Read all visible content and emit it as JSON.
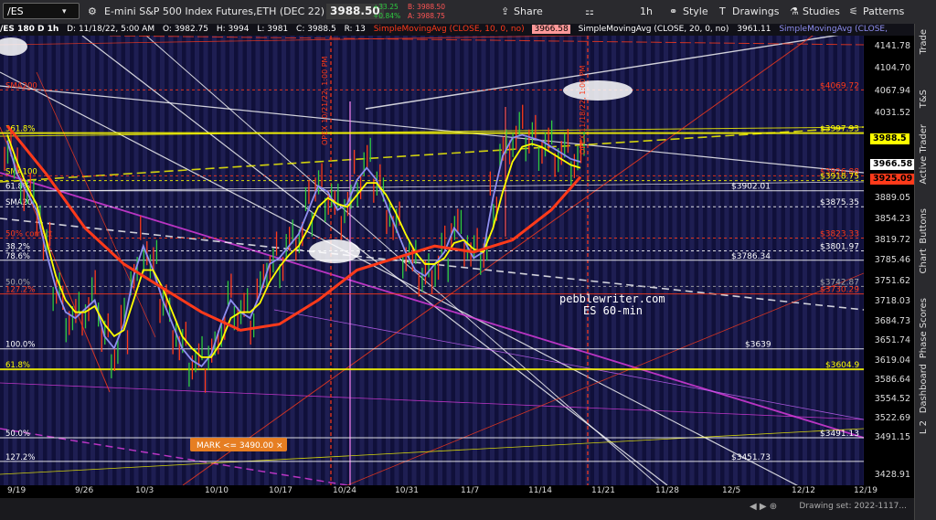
{
  "toolbar": {
    "symbol": "/ES",
    "description": "E-mini S&P 500 Index Futures,ETH (DEC 22)",
    "last_price": "3988.50",
    "net_change": "+33.25",
    "pct_change": "+0.84%",
    "bid": "B: 3988.50",
    "ask": "A: 3988.75",
    "share": "Share",
    "interval": "1h",
    "style": "Style",
    "drawings": "Drawings",
    "studies": "Studies",
    "patterns": "Patterns"
  },
  "header": {
    "chart_id": "/ES 180 D 1h",
    "date": "D: 11/18/22, 5:00 AM",
    "open": "O: 3982.75",
    "high": "H: 3994",
    "low": "L: 3981",
    "close": "C: 3988.5",
    "range": "R: 13",
    "sma10": "SimpleMovingAvg (CLOSE, 10, 0, no)",
    "sma10_val": "3966.58",
    "sma20": "SimpleMovingAvg (CLOSE, 20, 0, no)",
    "sma20_val": "3961.11",
    "sma_next": "SimpleMovingAvg (CLOSE,"
  },
  "side_tabs": [
    "Trade",
    "T&S",
    "Active Trader",
    "Buttons",
    "Chart",
    "Phase Scores",
    "Dashboard",
    "L 2"
  ],
  "status": {
    "drawing_set": "Drawing set: 2022-1117..."
  },
  "colors": {
    "bg": "#10103a",
    "stripe": "#2a2a66",
    "yellow": "#ffff00",
    "red": "#ff2a2a",
    "orange_red": "#ff4d00",
    "magenta": "#e23ce2",
    "white": "#ffffff",
    "orange_box": "#e67e22"
  },
  "chart_data": {
    "type": "line",
    "title": "/ES 180 D 1h",
    "ylim": [
      3412,
      4160
    ],
    "y_ticks": [
      4141.78,
      4104.7,
      4067.94,
      4031.52,
      3889.05,
      3854.23,
      3819.72,
      3785.46,
      3751.62,
      3718.03,
      3684.73,
      3651.74,
      3619.04,
      3586.64,
      3554.52,
      3522.69,
      3491.15,
      3428.91
    ],
    "x_ticks": [
      "9/19",
      "9/26",
      "10/3",
      "10/10",
      "10/17",
      "10/24",
      "10/31",
      "11/7",
      "11/14",
      "11/21",
      "11/28",
      "12/5",
      "12/12",
      "12/19"
    ],
    "grid": false,
    "legend": "none",
    "series": [
      {
        "name": "SimpleMovingAvg (CLOSE, 10, 0, no)",
        "color": "#8e8ef0",
        "x": [
          0,
          1,
          2,
          3,
          4,
          5,
          6,
          7,
          8,
          9,
          10,
          11,
          12,
          13,
          14,
          15,
          16,
          17,
          18,
          19,
          20,
          21,
          22,
          23,
          24,
          25,
          26,
          27,
          28,
          29,
          30,
          31,
          32,
          33,
          34,
          35,
          36,
          37,
          38,
          39,
          40,
          41,
          42,
          43,
          44,
          45,
          46,
          47,
          48,
          49,
          50,
          51,
          52,
          53,
          54,
          55,
          56,
          57,
          58,
          59
        ],
        "values": [
          3985,
          3930,
          3900,
          3870,
          3800,
          3740,
          3700,
          3690,
          3705,
          3720,
          3660,
          3640,
          3680,
          3760,
          3810,
          3770,
          3720,
          3680,
          3640,
          3620,
          3610,
          3630,
          3680,
          3720,
          3700,
          3690,
          3730,
          3780,
          3790,
          3810,
          3830,
          3870,
          3910,
          3900,
          3870,
          3880,
          3920,
          3940,
          3920,
          3880,
          3840,
          3800,
          3770,
          3760,
          3780,
          3800,
          3840,
          3820,
          3790,
          3800,
          3890,
          3960,
          3990,
          3995,
          3990,
          3985,
          3975,
          3965,
          3955,
          3950
        ]
      },
      {
        "name": "SimpleMovingAvg (CLOSE, 20, 0, no)",
        "color": "#ffff00",
        "x": [
          0,
          1,
          2,
          3,
          4,
          5,
          6,
          7,
          8,
          9,
          10,
          11,
          12,
          13,
          14,
          15,
          16,
          17,
          18,
          19,
          20,
          21,
          22,
          23,
          24,
          25,
          26,
          27,
          28,
          29,
          30,
          31,
          32,
          33,
          34,
          35,
          36,
          37,
          38,
          39,
          40,
          41,
          42,
          43,
          44,
          45,
          46,
          47,
          48,
          49,
          50,
          51,
          52,
          53,
          54,
          55,
          56,
          57,
          58,
          59
        ],
        "values": [
          3995,
          3950,
          3910,
          3880,
          3820,
          3760,
          3720,
          3700,
          3700,
          3710,
          3680,
          3660,
          3670,
          3720,
          3770,
          3770,
          3740,
          3700,
          3660,
          3640,
          3625,
          3625,
          3650,
          3690,
          3700,
          3700,
          3715,
          3750,
          3775,
          3795,
          3810,
          3840,
          3875,
          3890,
          3880,
          3875,
          3895,
          3915,
          3915,
          3895,
          3865,
          3830,
          3800,
          3780,
          3780,
          3790,
          3815,
          3820,
          3805,
          3800,
          3840,
          3900,
          3950,
          3975,
          3980,
          3975,
          3965,
          3955,
          3945,
          3940
        ]
      },
      {
        "name": "SMA50",
        "color": "#ff3a1a",
        "x": [
          0,
          4,
          8,
          12,
          16,
          20,
          24,
          28,
          32,
          36,
          40,
          44,
          48,
          52,
          56,
          59
        ],
        "values": [
          4010,
          3930,
          3840,
          3780,
          3740,
          3700,
          3670,
          3680,
          3720,
          3770,
          3790,
          3810,
          3800,
          3820,
          3870,
          3925
        ]
      }
    ],
    "horizontal_levels": [
      {
        "label": "$4069.72",
        "value": 4069.72,
        "color": "#ff3a1a",
        "style": "dotted"
      },
      {
        "label": "$3997.93",
        "value": 3997.93,
        "color": "#ffff00",
        "style": "solid"
      },
      {
        "label": "$3926.88",
        "value": 3926.88,
        "color": "#ff3a1a",
        "style": "dotted"
      },
      {
        "label": "$3918.75",
        "value": 3918.75,
        "color": "#ffff00",
        "style": "dotted"
      },
      {
        "label": "$3902.01",
        "value": 3902.01,
        "color": "#ffffff",
        "style": "solid"
      },
      {
        "label": "$3875.35",
        "value": 3875.35,
        "color": "#ffffff",
        "style": "dotted"
      },
      {
        "label": "$3823.33",
        "value": 3823.33,
        "color": "#ff3a1a",
        "style": "dotted"
      },
      {
        "label": "$3801.97",
        "value": 3801.97,
        "color": "#ffffff",
        "style": "dotted"
      },
      {
        "label": "$3786.34",
        "value": 3786.34,
        "color": "#ffffff",
        "style": "solid"
      },
      {
        "label": "$3742.87",
        "value": 3742.87,
        "color": "#aaaaaa",
        "style": "dotted"
      },
      {
        "label": "$3730.29",
        "value": 3730.29,
        "color": "#ff3a1a",
        "style": "solid"
      },
      {
        "label": "$3639",
        "value": 3639,
        "color": "#ffffff",
        "style": "solid"
      },
      {
        "label": "$3604.9",
        "value": 3604.9,
        "color": "#ffff00",
        "style": "solid"
      },
      {
        "label": "$3491.13",
        "value": 3491.13,
        "color": "#ffffff",
        "style": "solid"
      },
      {
        "label": "$3451.73",
        "value": 3451.73,
        "color": "#ffffff",
        "style": "solid"
      }
    ],
    "price_tags": [
      {
        "label": "3988.5",
        "value": 3988.5,
        "bg": "#ffff00",
        "fg": "#000000"
      },
      {
        "label": "3966.58",
        "value": 3966.58,
        "bg": "#ffffff",
        "fg": "#000000"
      },
      {
        "label": "3925.09",
        "value": 3925.09,
        "bg": "#ff3a1a",
        "fg": "#000000"
      }
    ],
    "left_annotations": [
      {
        "text": "SMA200",
        "value": 4069.72,
        "color": "#ff3a1a"
      },
      {
        "text": "361.8%",
        "value": 3997.93,
        "color": "#ffff00"
      },
      {
        "text": "SMA100",
        "value": 3926.88,
        "color": "#ffff00"
      },
      {
        "text": "61.8%",
        "value": 3902.01,
        "color": "#ffffff"
      },
      {
        "text": "SMA20",
        "value": 3875.35,
        "color": "#ffffff"
      },
      {
        "text": "50% correct",
        "value": 3823.33,
        "color": "#ff3a1a"
      },
      {
        "text": "38.2%",
        "value": 3801.97,
        "color": "#ffffff"
      },
      {
        "text": "78.6%",
        "value": 3786.34,
        "color": "#ffffff"
      },
      {
        "text": "50.0%",
        "value": 3742.87,
        "color": "#aaaaaa"
      },
      {
        "text": "127.2%",
        "value": 3730.29,
        "color": "#ff3a1a"
      },
      {
        "text": "100.0%",
        "value": 3639,
        "color": "#ffffff"
      },
      {
        "text": "61.8%",
        "value": 3604.9,
        "color": "#ffff00"
      },
      {
        "text": "50.0%",
        "value": 3491.13,
        "color": "#ffffff"
      },
      {
        "text": "127.2%",
        "value": 3451.73,
        "color": "#ffffff"
      }
    ],
    "annotations": [
      {
        "text": "pebblewriter.com"
      },
      {
        "text": "ES 60-min"
      },
      {
        "text": "MARK <= 3490.00 ×"
      },
      {
        "text": "OPEX 10/21/22, 1:00 PM"
      },
      {
        "text": "OPEX 11/18/22, 1:00 PM"
      }
    ]
  }
}
